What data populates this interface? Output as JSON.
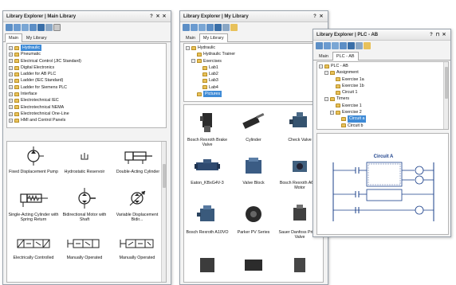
{
  "main_library": {
    "title": "Library Explorer | Main Library",
    "title_buttons": [
      "?",
      "✕",
      "✕"
    ],
    "tabs": [
      "Main",
      "My Library"
    ],
    "tree": [
      {
        "label": "Hydraulic",
        "selected": true
      },
      {
        "label": "Pneumatic"
      },
      {
        "label": "Electrical Control (JIC Standard)"
      },
      {
        "label": "Digital Electronics"
      },
      {
        "label": "Ladder for AB PLC"
      },
      {
        "label": "Ladder (IEC Standard)"
      },
      {
        "label": "Ladder for Siemens PLC"
      },
      {
        "label": "Interface"
      },
      {
        "label": "Electrotechnical IEC"
      },
      {
        "label": "Electrotechnical NEMA"
      },
      {
        "label": "Electrotechnical One-Line"
      },
      {
        "label": "HMI and Control Panels"
      }
    ],
    "components": [
      {
        "label": "Fixed Displacement Pump"
      },
      {
        "label": "Hydrostatic Reservoir"
      },
      {
        "label": "Double-Acting Cylinder"
      },
      {
        "label": "Single-Acting Cylinder with Spring Return"
      },
      {
        "label": "Bidirectional Motor with Shaft"
      },
      {
        "label": "Variable Displacement Bidir..."
      },
      {
        "label": "Electrically Controlled"
      },
      {
        "label": "Manually Operated"
      },
      {
        "label": "Manually Operated"
      }
    ]
  },
  "my_library": {
    "title": "Library Explorer | My Library",
    "title_buttons": [
      "?",
      "✕"
    ],
    "tabs": [
      "Main",
      "My Library"
    ],
    "tree": [
      {
        "label": "Hydraulic",
        "level": 0,
        "toggle": "−"
      },
      {
        "label": "Hydraulic Trainer",
        "level": 1
      },
      {
        "label": "Exercises",
        "level": 1,
        "toggle": "−"
      },
      {
        "label": "Lab1",
        "level": 2
      },
      {
        "label": "Lab2",
        "level": 2
      },
      {
        "label": "Lab3",
        "level": 2
      },
      {
        "label": "Lab4",
        "level": 2
      },
      {
        "label": "Pictures",
        "level": 1,
        "selected": true
      }
    ],
    "components": [
      {
        "label": "Bosch Rexroth Brake Valve"
      },
      {
        "label": "Cylinder"
      },
      {
        "label": "Check Valve"
      },
      {
        "label": "Eaton_KBxG4V-3"
      },
      {
        "label": "Valve Block"
      },
      {
        "label": "Bosch Rexroth A6VM Motor"
      },
      {
        "label": "Bosch Rexroth A10VO"
      },
      {
        "label": "Parker PV Series"
      },
      {
        "label": "Sauer Danfoss Priority Valve"
      }
    ]
  },
  "plc_library": {
    "title": "Library Explorer | PLC - AB",
    "title_buttons": [
      "?",
      "⊓",
      "✕"
    ],
    "tabs": [
      "Main",
      "PLC - AB"
    ],
    "tree": [
      {
        "label": "PLC - AB",
        "level": 0,
        "toggle": "−"
      },
      {
        "label": "Assignment",
        "level": 1,
        "toggle": "−"
      },
      {
        "label": "Exercise 1a",
        "level": 2
      },
      {
        "label": "Exercise 1b",
        "level": 2
      },
      {
        "label": "Circuit 1",
        "level": 2
      },
      {
        "label": "Timers",
        "level": 1,
        "toggle": "−"
      },
      {
        "label": "Exercise 1",
        "level": 2
      },
      {
        "label": "Exercise 2",
        "level": 2,
        "toggle": "−"
      },
      {
        "label": "Circuit a",
        "level": 3,
        "selected": true
      },
      {
        "label": "Circuit b",
        "level": 3
      }
    ],
    "preview_title": "Circuit A"
  },
  "colors": {
    "selection": "#3f8bd6",
    "folder": "#e8c15a",
    "window_border": "#9aa3ad"
  }
}
